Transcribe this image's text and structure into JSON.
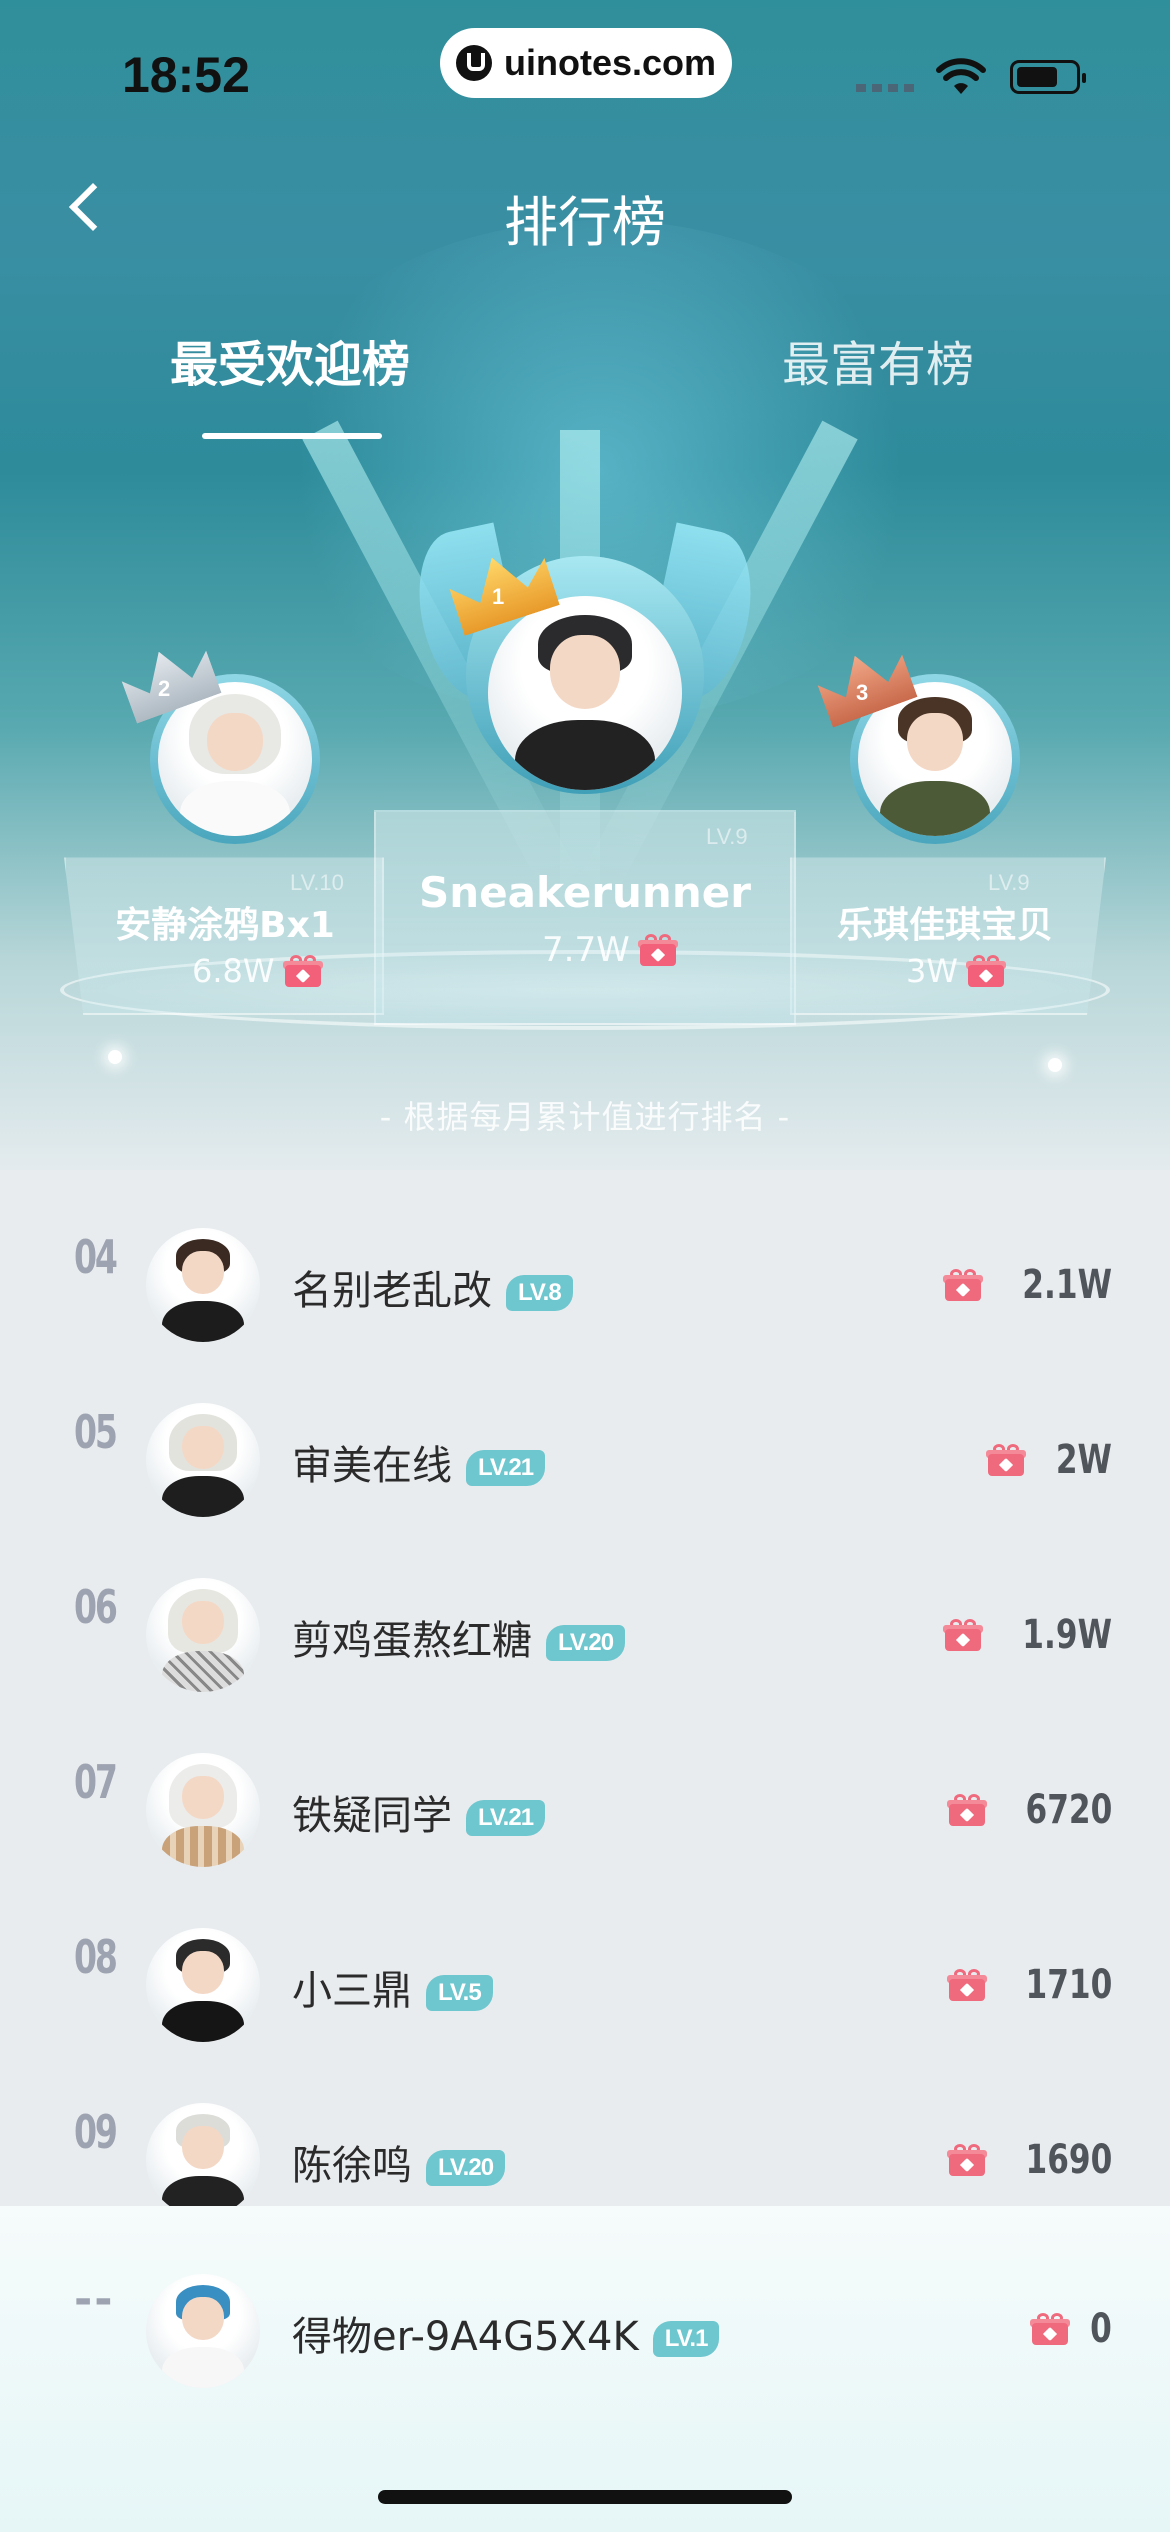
{
  "status_bar": {
    "time": "18:52",
    "url": "uinotes.com"
  },
  "nav": {
    "title": "排行榜"
  },
  "tabs": [
    {
      "label": "最受欢迎榜",
      "active": true
    },
    {
      "label": "最富有榜",
      "active": false
    }
  ],
  "podium": {
    "first": {
      "rank": "1",
      "name": "Sneakerunner",
      "score": "7.7W",
      "level": "LV.9"
    },
    "second": {
      "rank": "2",
      "name": "安静涂鸦Bx1",
      "score": "6.8W",
      "level": "LV.10"
    },
    "third": {
      "rank": "3",
      "name": "乐琪佳琪宝贝",
      "score": "3W",
      "level": "LV.9"
    }
  },
  "hint": "- 根据每月累计值进行排名 -",
  "list": [
    {
      "rank": "04",
      "name": "名别老乱改",
      "level": "LV.8",
      "score": "2.1W"
    },
    {
      "rank": "05",
      "name": "审美在线",
      "level": "LV.21",
      "score": "2W"
    },
    {
      "rank": "06",
      "name": "剪鸡蛋熬红糖",
      "level": "LV.20",
      "score": "1.9W"
    },
    {
      "rank": "07",
      "name": "铁疑同学",
      "level": "LV.21",
      "score": "6720"
    },
    {
      "rank": "08",
      "name": "小三鼎",
      "level": "LV.5",
      "score": "1710"
    },
    {
      "rank": "09",
      "name": "陈徐鸣",
      "level": "LV.20",
      "score": "1690"
    }
  ],
  "self": {
    "rank": "--",
    "name": "得物er-9A4G5X4K",
    "level": "LV.1",
    "score": "0"
  },
  "colors": {
    "accent": "#6ec7cf",
    "gift": "#f06a7e",
    "gold": "#f4c04a",
    "silver": "#cfd6dc",
    "bronze": "#e08c6c"
  },
  "icons": {
    "back": "chevron-left-icon",
    "gift": "gift-icon",
    "crown": "crown-icon"
  }
}
